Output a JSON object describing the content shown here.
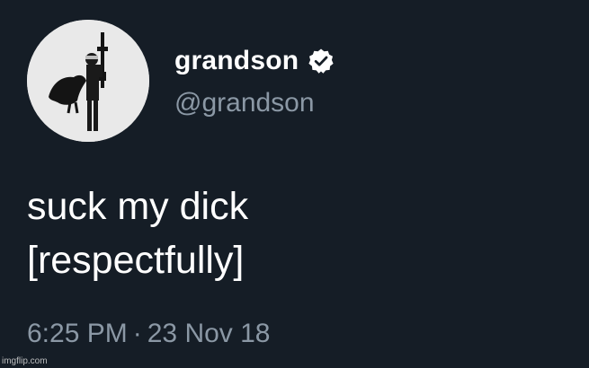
{
  "tweet": {
    "author": {
      "display_name": "grandson",
      "handle": "@grandson",
      "verified": true,
      "avatar_icon": "avatar-figure-with-rifle-and-bird-icon",
      "verified_icon": "verified-check-badge-icon"
    },
    "text_lines": [
      "suck my dick",
      "[respectfully]"
    ],
    "time": "6:25 PM",
    "separator": "·",
    "date": "23 Nov 18"
  },
  "watermark": {
    "text": "imgflip.com"
  },
  "colors": {
    "background": "#151d26",
    "text_primary": "#ffffff",
    "text_secondary": "#8b98a5",
    "avatar_bg": "#e9e9e9"
  }
}
